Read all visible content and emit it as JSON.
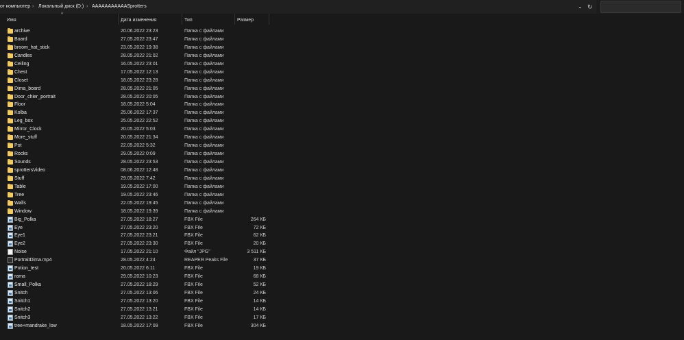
{
  "breadcrumb": {
    "root": "от компьютер",
    "drive": "Локальный диск (D:)",
    "folder": "AAAAAAAAAAASprotters"
  },
  "columns": {
    "name": "Имя",
    "date": "Дата изменения",
    "type": "Тип",
    "size": "Размер"
  },
  "files": [
    {
      "name": "archive",
      "date": "20.06.2022 23:23",
      "type": "Папка с файлами",
      "size": "",
      "icon": "folder"
    },
    {
      "name": "Board",
      "date": "27.05.2022 23:47",
      "type": "Папка с файлами",
      "size": "",
      "icon": "folder"
    },
    {
      "name": "broom_hat_stick",
      "date": "23.05.2022 19:38",
      "type": "Папка с файлами",
      "size": "",
      "icon": "folder"
    },
    {
      "name": "Candles",
      "date": "28.05.2022 21:02",
      "type": "Папка с файлами",
      "size": "",
      "icon": "folder"
    },
    {
      "name": "Ceiling",
      "date": "16.05.2022 23:01",
      "type": "Папка с файлами",
      "size": "",
      "icon": "folder"
    },
    {
      "name": "Chest",
      "date": "17.05.2022 12:13",
      "type": "Папка с файлами",
      "size": "",
      "icon": "folder"
    },
    {
      "name": "Closet",
      "date": "18.05.2022 23:28",
      "type": "Папка с файлами",
      "size": "",
      "icon": "folder"
    },
    {
      "name": "Dima_board",
      "date": "28.05.2022 21:05",
      "type": "Папка с файлами",
      "size": "",
      "icon": "folder"
    },
    {
      "name": "Door_chier_portrait",
      "date": "28.05.2022 20:05",
      "type": "Папка с файлами",
      "size": "",
      "icon": "folder"
    },
    {
      "name": "Floor",
      "date": "18.05.2022 5:04",
      "type": "Папка с файлами",
      "size": "",
      "icon": "folder"
    },
    {
      "name": "Kolba",
      "date": "25.06.2022 17:37",
      "type": "Папка с файлами",
      "size": "",
      "icon": "folder"
    },
    {
      "name": "Leg_box",
      "date": "25.05.2022 22:52",
      "type": "Папка с файлами",
      "size": "",
      "icon": "folder"
    },
    {
      "name": "Mirror_Clock",
      "date": "20.05.2022 5:03",
      "type": "Папка с файлами",
      "size": "",
      "icon": "folder"
    },
    {
      "name": "More_stuff",
      "date": "20.05.2022 21:34",
      "type": "Папка с файлами",
      "size": "",
      "icon": "folder"
    },
    {
      "name": "Pot",
      "date": "22.05.2022 5:32",
      "type": "Папка с файлами",
      "size": "",
      "icon": "folder"
    },
    {
      "name": "Rocks",
      "date": "29.05.2022 0:09",
      "type": "Папка с файлами",
      "size": "",
      "icon": "folder"
    },
    {
      "name": "Sounds",
      "date": "28.05.2022 23:53",
      "type": "Папка с файлами",
      "size": "",
      "icon": "folder"
    },
    {
      "name": "sprottersVideo",
      "date": "08.06.2022 12:48",
      "type": "Папка с файлами",
      "size": "",
      "icon": "folder"
    },
    {
      "name": "Stuff",
      "date": "29.05.2022 7:42",
      "type": "Папка с файлами",
      "size": "",
      "icon": "folder"
    },
    {
      "name": "Table",
      "date": "19.05.2022 17:00",
      "type": "Папка с файлами",
      "size": "",
      "icon": "folder"
    },
    {
      "name": "Tree",
      "date": "19.05.2022 23:46",
      "type": "Папка с файлами",
      "size": "",
      "icon": "folder"
    },
    {
      "name": "Walls",
      "date": "22.05.2022 19:45",
      "type": "Папка с файлами",
      "size": "",
      "icon": "folder"
    },
    {
      "name": "Window",
      "date": "18.05.2022 19:39",
      "type": "Папка с файлами",
      "size": "",
      "icon": "folder"
    },
    {
      "name": "Big_Polka",
      "date": "27.05.2022 18:27",
      "type": "FBX File",
      "size": "264 КБ",
      "icon": "fbx"
    },
    {
      "name": "Eye",
      "date": "27.05.2022 23:20",
      "type": "FBX File",
      "size": "72 КБ",
      "icon": "fbx"
    },
    {
      "name": "Eye1",
      "date": "27.05.2022 23:21",
      "type": "FBX File",
      "size": "62 КБ",
      "icon": "fbx"
    },
    {
      "name": "Eye2",
      "date": "27.05.2022 23:30",
      "type": "FBX File",
      "size": "20 КБ",
      "icon": "fbx"
    },
    {
      "name": "Noise",
      "date": "17.05.2022 21:10",
      "type": "Файл \"JPG\"",
      "size": "3 511 КБ",
      "icon": "image"
    },
    {
      "name": "PortraitDima.mp4",
      "date": "28.05.2022 4:24",
      "type": "REAPER Peaks File",
      "size": "37 КБ",
      "icon": "peaks"
    },
    {
      "name": "Potion_test",
      "date": "20.05.2022 6:11",
      "type": "FBX File",
      "size": "19 КБ",
      "icon": "fbx"
    },
    {
      "name": "rama",
      "date": "29.05.2022 10:23",
      "type": "FBX File",
      "size": "68 КБ",
      "icon": "fbx"
    },
    {
      "name": "Small_Polka",
      "date": "27.05.2022 18:29",
      "type": "FBX File",
      "size": "52 КБ",
      "icon": "fbx"
    },
    {
      "name": "Snitch",
      "date": "27.05.2022 13:06",
      "type": "FBX File",
      "size": "24 КБ",
      "icon": "fbx"
    },
    {
      "name": "Snitch1",
      "date": "27.05.2022 13:20",
      "type": "FBX File",
      "size": "14 КБ",
      "icon": "fbx"
    },
    {
      "name": "Snitch2",
      "date": "27.05.2022 13:21",
      "type": "FBX File",
      "size": "14 КБ",
      "icon": "fbx"
    },
    {
      "name": "Snitch3",
      "date": "27.05.2022 13:22",
      "type": "FBX File",
      "size": "17 КБ",
      "icon": "fbx"
    },
    {
      "name": "tree+mandrake_low",
      "date": "18.05.2022 17:09",
      "type": "FBX File",
      "size": "304 КБ",
      "icon": "fbx"
    }
  ]
}
